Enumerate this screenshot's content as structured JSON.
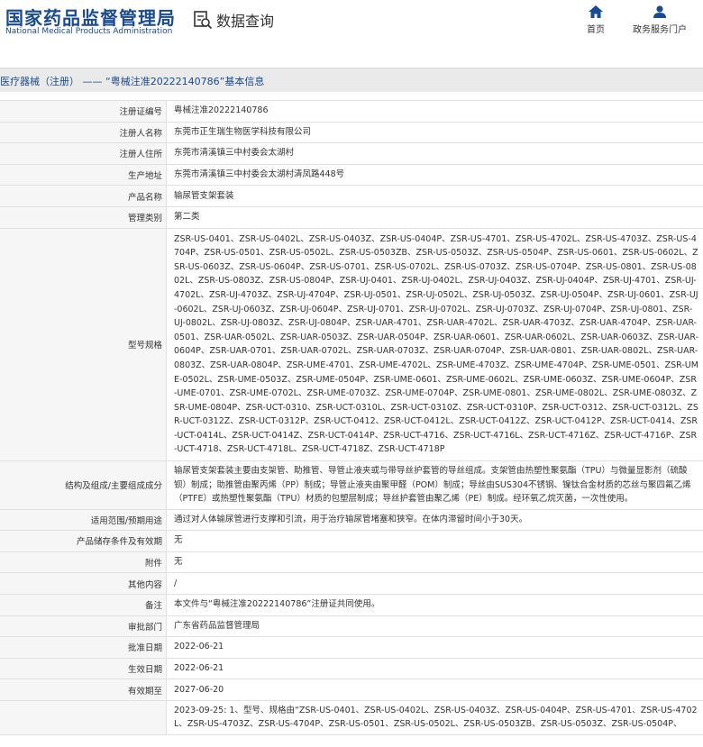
{
  "header": {
    "logo_cn": "国家药品监督管理局",
    "logo_en": "National Medical Products Administration",
    "query_label": "数据查询",
    "nav": [
      {
        "label": "首页",
        "icon": "home-icon"
      },
      {
        "label": "政务服务门户",
        "icon": "user-icon"
      }
    ],
    "brand_color": "#1a4b8c"
  },
  "titlebar": {
    "text": "医疗器械（注册） —— “粤械注准20222140786”基本信息"
  },
  "rows": [
    {
      "label": "注册证编号",
      "value": "粤械注准20222140786"
    },
    {
      "label": "注册人名称",
      "value": "东莞市正生瑞生物医学科技有限公司"
    },
    {
      "label": "注册人住所",
      "value": "东莞市清溪镇三中村委会太湖村"
    },
    {
      "label": "生产地址",
      "value": "东莞市清溪镇三中村委会太湖村清凤路448号"
    },
    {
      "label": "产品名称",
      "value": "输尿管支架套装"
    },
    {
      "label": "管理类别",
      "value": "第二类"
    },
    {
      "label": "型号规格",
      "value": "ZSR-US-0401、ZSR-US-0402L、ZSR-US-0403Z、ZSR-US-0404P、ZSR-US-4701、ZSR-US-4702L、ZSR-US-4703Z、ZSR-US-4704P、ZSR-US-0501、ZSR-US-0502L、ZSR-US-0503ZB、ZSR-US-0503Z、ZSR-US-0504P、ZSR-US-0601、ZSR-US-0602L、ZSR-US-0603Z、ZSR-US-0604P、ZSR-US-0701、ZSR-US-0702L、ZSR-US-0703Z、ZSR-US-0704P、ZSR-US-0801、ZSR-US-0802L、ZSR-US-0803Z、ZSR-US-0804P、ZSR-UJ-0401、ZSR-UJ-0402L、ZSR-UJ-0403Z、ZSR-UJ-0404P、ZSR-UJ-4701、ZSR-UJ-4702L、ZSR-UJ-4703Z、ZSR-UJ-4704P、ZSR-UJ-0501、ZSR-UJ-0502L、ZSR-UJ-0503Z、ZSR-UJ-0504P、ZSR-UJ-0601、ZSR-UJ-0602L、ZSR-UJ-0603Z、ZSR-UJ-0604P、ZSR-UJ-0701、ZSR-UJ-0702L、ZSR-UJ-0703Z、ZSR-UJ-0704P、ZSR-UJ-0801、ZSR-UJ-0802L、ZSR-UJ-0803Z、ZSR-UJ-0804P、ZSR-UAR-4701、ZSR-UAR-4702L、ZSR-UAR-4703Z、ZSR-UAR-4704P、ZSR-UAR-0501、ZSR-UAR-0502L、ZSR-UAR-0503Z、ZSR-UAR-0504P、ZSR-UAR-0601、ZSR-UAR-0602L、ZSR-UAR-0603Z、ZSR-UAR-0604P、ZSR-UAR-0701、ZSR-UAR-0702L、ZSR-UAR-0703Z、ZSR-UAR-0704P、ZSR-UAR-0801、ZSR-UAR-0802L、ZSR-UAR-0803Z、ZSR-UAR-0804P、ZSR-UME-4701、ZSR-UME-4702L、ZSR-UME-4703Z、ZSR-UME-4704P、ZSR-UME-0501、ZSR-UME-0502L、ZSR-UME-0503Z、ZSR-UME-0504P、ZSR-UME-0601、ZSR-UME-0602L、ZSR-UME-0603Z、ZSR-UME-0604P、ZSR-UME-0701、ZSR-UME-0702L、ZSR-UME-0703Z、ZSR-UME-0704P、ZSR-UME-0801、ZSR-UME-0802L、ZSR-UME-0803Z、ZSR-UME-0804P、ZSR-UCT-0310、ZSR-UCT-0310L、ZSR-UCT-0310Z、ZSR-UCT-0310P、ZSR-UCT-0312、ZSR-UCT-0312L、ZSR-UCT-0312Z、ZSR-UCT-0312P、ZSR-UCT-0412、ZSR-UCT-0412L、ZSR-UCT-0412Z、ZSR-UCT-0412P、ZSR-UCT-0414、ZSR-UCT-0414L、ZSR-UCT-0414Z、ZSR-UCT-0414P、ZSR-UCT-4716、ZSR-UCT-4716L、ZSR-UCT-4716Z、ZSR-UCT-4716P、ZSR-UCT-4718、ZSR-UCT-4718L、ZSR-UCT-4718Z、ZSR-UCT-4718P"
    },
    {
      "label": "结构及组成/主要组成成分",
      "value": "输尿管支架套装主要由支架管、助推管、导管止液夹或与带导丝护套管的导丝组成。支架管由热塑性聚氨酯（TPU）与微量显影剂（硫酸钡）制成；助推管由聚丙烯（PP）制成；导管止液夹由聚甲醛（POM）制成；导丝由SUS304不锈钢、镍钛合金材质的芯丝与聚四氟乙烯（PTFE）或热塑性聚氨酯（TPU）材质的包塑层制成；导丝护套管由聚乙烯（PE）制成。经环氧乙烷灭菌，一次性使用。"
    },
    {
      "label": "适用范围/预期用途",
      "value": "通过对人体输尿管进行支撑和引流，用于治疗输尿管堵塞和狭窄。在体内滞留时间小于30天。"
    },
    {
      "label": "产品储存条件及有效期",
      "value": "无"
    },
    {
      "label": "附件",
      "value": "无"
    },
    {
      "label": "其他内容",
      "value": "/"
    },
    {
      "label": "备注",
      "value": "本文件与“粤械注准20222140786”注册证共同使用。"
    },
    {
      "label": "审批部门",
      "value": "广东省药品监督管理局"
    },
    {
      "label": "批准日期",
      "value": "2022-06-21"
    },
    {
      "label": "生效日期",
      "value": "2022-06-21"
    },
    {
      "label": "有效期至",
      "value": "2027-06-20"
    },
    {
      "label": "",
      "value": "2023-09-25: 1、型号、规格由“ZSR-US-0401、ZSR-US-0402L、ZSR-US-0403Z、ZSR-US-0404P、ZSR-US-4701、ZSR-US-4702L、ZSR-US-4703Z、ZSR-US-4704P、ZSR-US-0501、ZSR-US-0502L、ZSR-US-0503ZB、ZSR-US-0503Z、ZSR-US-0504P、"
    }
  ]
}
